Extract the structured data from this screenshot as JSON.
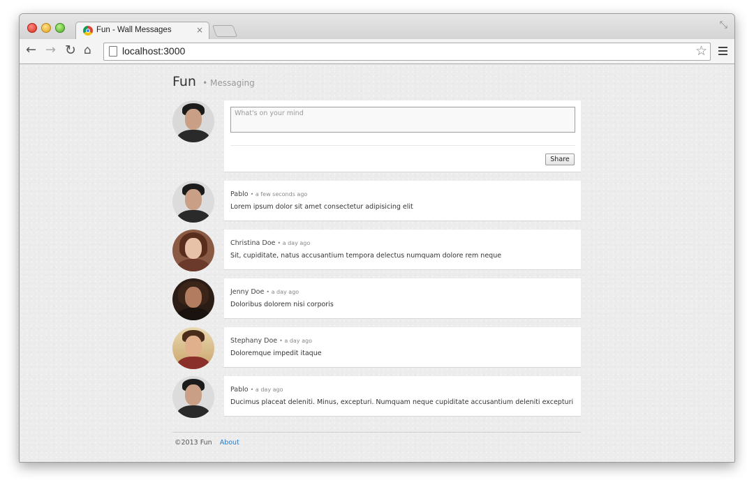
{
  "browser": {
    "tab_title": "Fun - Wall Messages",
    "tab_close": "×",
    "url": "localhost:3000",
    "icons": {
      "back": "←",
      "forward": "→",
      "reload": "↻",
      "home": "⌂",
      "star": "☆",
      "restore": "⤡"
    }
  },
  "header": {
    "brand": "Fun",
    "subtitle": "• Messaging"
  },
  "composer": {
    "placeholder": "What's on your mind",
    "share_label": "Share"
  },
  "posts": [
    {
      "author": "Pablo",
      "time": "• a few seconds ago",
      "text": "Lorem ipsum dolor sit amet consectetur adipisicing elit"
    },
    {
      "author": "Christina Doe",
      "time": "• a day ago",
      "text": "Sit, cupiditate, natus accusantium tempora delectus numquam dolore rem neque"
    },
    {
      "author": "Jenny Doe",
      "time": "• a day ago",
      "text": "Doloribus dolorem nisi corporis"
    },
    {
      "author": "Stephany Doe",
      "time": "• a day ago",
      "text": "Doloremque impedit itaque"
    },
    {
      "author": "Pablo",
      "time": "• a day ago",
      "text": "Ducimus placeat deleniti. Minus, excepturi. Numquam neque cupiditate accusantium deleniti excepturi"
    }
  ],
  "footer": {
    "copyright": "©2013 Fun",
    "about": "About"
  },
  "colors": {
    "link": "#2a7abf",
    "page_bg": "#ececec"
  }
}
